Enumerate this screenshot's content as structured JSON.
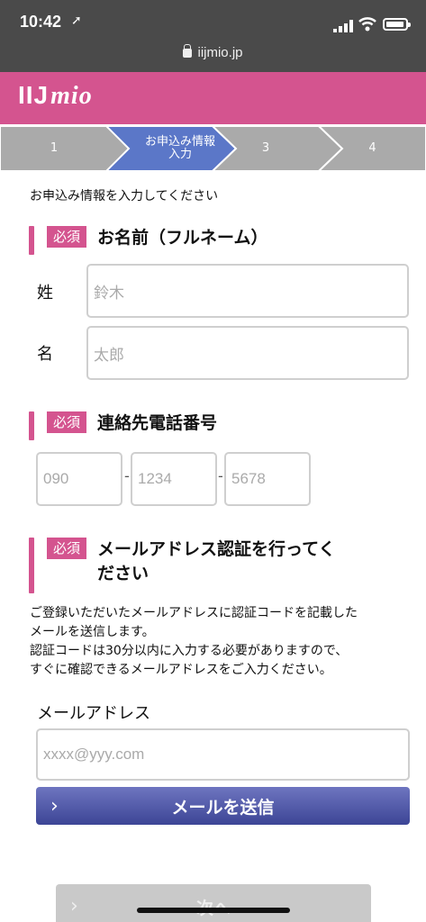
{
  "status_bar": {
    "time": "10:42",
    "url": "iijmio.jp"
  },
  "header": {
    "logo_main": "IIJ",
    "logo_sub": "mio"
  },
  "steps": [
    "1",
    "お申込み情報\n入力",
    "3",
    "4"
  ],
  "intro": "お申込み情報を入力してください",
  "required_badge": "必須",
  "name_section": {
    "title": "お名前（フルネーム）",
    "last_label": "姓",
    "last_placeholder": "鈴木",
    "first_label": "名",
    "first_placeholder": "太郎"
  },
  "phone_section": {
    "title": "連絡先電話番号",
    "part1_placeholder": "090",
    "part2_placeholder": "1234",
    "part3_placeholder": "5678",
    "separator": "-"
  },
  "email_section": {
    "title_line1": "メールアドレス認証を行ってく",
    "title_line2": "ださい",
    "desc_line1": "ご登録いただいたメールアドレスに認証コードを記載した",
    "desc_line2": "メールを送信します。",
    "desc_line3": "認証コードは30分以内に入力する必要がありますので、",
    "desc_line4": "すぐに確認できるメールアドレスをご入力ください。",
    "label": "メールアドレス",
    "placeholder": "xxxx@yyy.com",
    "send_button": "メールを送信"
  },
  "next_button": "次へ",
  "colors": {
    "brand": "#d4548f",
    "active_step": "#5b77c8",
    "button": "#3c4596"
  }
}
